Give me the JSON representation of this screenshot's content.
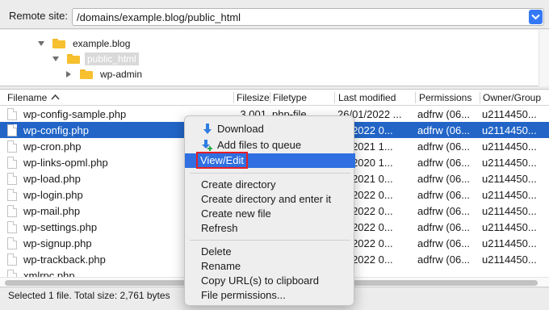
{
  "remote": {
    "label": "Remote site:",
    "path": "/domains/example.blog/public_html"
  },
  "tree": {
    "items": [
      {
        "label": "example.blog"
      },
      {
        "label": "public_html"
      },
      {
        "label": "wp-admin"
      }
    ]
  },
  "columns": {
    "filename": "Filename",
    "filesize": "Filesize",
    "filetype": "Filetype",
    "modified": "Last modified",
    "permissions": "Permissions",
    "owner": "Owner/Group"
  },
  "files": [
    {
      "name": "wp-config-sample.php",
      "size": "3,001",
      "type": "php-file",
      "modified": "26/01/2022 ...",
      "perm": "adfrw (06...",
      "owner": "u2114450..."
    },
    {
      "name": "wp-config.php",
      "size": "",
      "type": "",
      "modified": "02/2022 0...",
      "perm": "adfrw (06...",
      "owner": "u2114450..."
    },
    {
      "name": "wp-cron.php",
      "size": "",
      "type": "",
      "modified": "02/2021 1...",
      "perm": "adfrw (06...",
      "owner": "u2114450..."
    },
    {
      "name": "wp-links-opml.php",
      "size": "",
      "type": "",
      "modified": "02/2020 1...",
      "perm": "adfrw (06...",
      "owner": "u2114450..."
    },
    {
      "name": "wp-load.php",
      "size": "",
      "type": "",
      "modified": "07/2021 0...",
      "perm": "adfrw (06...",
      "owner": "u2114450..."
    },
    {
      "name": "wp-login.php",
      "size": "",
      "type": "",
      "modified": "01/2022 0...",
      "perm": "adfrw (06...",
      "owner": "u2114450..."
    },
    {
      "name": "wp-mail.php",
      "size": "",
      "type": "",
      "modified": "01/2022 0...",
      "perm": "adfrw (06...",
      "owner": "u2114450..."
    },
    {
      "name": "wp-settings.php",
      "size": "",
      "type": "",
      "modified": "01/2022 0...",
      "perm": "adfrw (06...",
      "owner": "u2114450..."
    },
    {
      "name": "wp-signup.php",
      "size": "",
      "type": "",
      "modified": "01/2022 0...",
      "perm": "adfrw (06...",
      "owner": "u2114450..."
    },
    {
      "name": "wp-trackback.php",
      "size": "",
      "type": "",
      "modified": "01/2022 0...",
      "perm": "adfrw (06...",
      "owner": "u2114450..."
    },
    {
      "name": "xmlrpc.php",
      "size": "",
      "type": "",
      "modified": "",
      "perm": "",
      "owner": ""
    }
  ],
  "status": "Selected 1 file. Total size: 2,761 bytes",
  "menu": {
    "download": "Download",
    "add_queue": "Add files to queue",
    "view_edit": "View/Edit",
    "create_dir": "Create directory",
    "create_dir_enter": "Create directory and enter it",
    "create_file": "Create new file",
    "refresh": "Refresh",
    "delete": "Delete",
    "rename": "Rename",
    "copy_url": "Copy URL(s) to clipboard",
    "file_perms": "File permissions..."
  },
  "colors": {
    "selection": "#2265c7",
    "menu_highlight": "#2f6fe1",
    "annotation": "#e41e26",
    "folder": "#f6c02f"
  }
}
